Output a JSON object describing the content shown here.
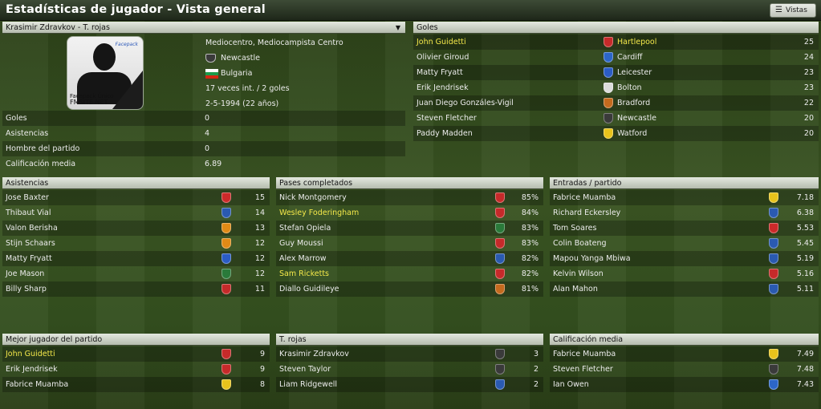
{
  "title": "Estadísticas de jugador - Vista general",
  "views_label": "Vistas",
  "player": {
    "header": "Krasimir Zdravkov - T. rojas",
    "photo_caption_1": "Facepack Único",
    "photo_caption_2": "FMSITE.NET",
    "position": "Mediocentro, Mediocampista Centro",
    "club": "Newcastle",
    "nation": "Bulgaria",
    "caps": "17 veces int. / 2 goles",
    "dob": "2-5-1994 (22 años)",
    "stats": [
      {
        "label": "Goles",
        "value": "0"
      },
      {
        "label": "Asistencias",
        "value": "4"
      },
      {
        "label": "Hombre del partido",
        "value": "0"
      },
      {
        "label": "Calificación media",
        "value": "6.89"
      }
    ]
  },
  "goles": {
    "header": "Goles",
    "rows": [
      {
        "name": "John Guidetti",
        "club": "Hartlepool",
        "value": "25",
        "hl": true,
        "c": "#c62a2a"
      },
      {
        "name": "Olivier Giroud",
        "club": "Cardiff",
        "value": "24",
        "c": "#2c66c8"
      },
      {
        "name": "Matty Fryatt",
        "club": "Leicester",
        "value": "23",
        "c": "#2b5cc4"
      },
      {
        "name": "Erik Jendrisek",
        "club": "Bolton",
        "value": "23",
        "c": "#dcdcdc"
      },
      {
        "name": "Juan Diego Gonzáles-Vigil",
        "club": "Bradford",
        "value": "22",
        "c": "#c46a1e"
      },
      {
        "name": "Steven Fletcher",
        "club": "Newcastle",
        "value": "20",
        "c": "#3a3a3a"
      },
      {
        "name": "Paddy Madden",
        "club": "Watford",
        "value": "20",
        "c": "#e8c31c"
      }
    ]
  },
  "asistencias": {
    "header": "Asistencias",
    "rows": [
      {
        "name": "Jose Baxter",
        "value": "15",
        "c": "#cc2a2a"
      },
      {
        "name": "Thibaut Vial",
        "value": "14",
        "c": "#2a5ab0"
      },
      {
        "name": "Valon Berisha",
        "value": "13",
        "c": "#e08a16"
      },
      {
        "name": "Stijn Schaars",
        "value": "12",
        "c": "#e08a16"
      },
      {
        "name": "Matty Fryatt",
        "value": "12",
        "c": "#2b5cc4"
      },
      {
        "name": "Joe Mason",
        "value": "12",
        "c": "#2a7a3a"
      },
      {
        "name": "Billy Sharp",
        "value": "11",
        "c": "#c62a2a"
      }
    ]
  },
  "pases": {
    "header": "Pases completados",
    "rows": [
      {
        "name": "Nick Montgomery",
        "value": "85%",
        "c": "#c62a2a"
      },
      {
        "name": "Wesley Foderingham",
        "value": "84%",
        "hl": true,
        "c": "#c62a2a"
      },
      {
        "name": "Stefan Opiela",
        "value": "83%",
        "c": "#2a7a3a"
      },
      {
        "name": "Guy Moussi",
        "value": "83%",
        "c": "#c62a2a"
      },
      {
        "name": "Alex Marrow",
        "value": "82%",
        "c": "#2a5ab0"
      },
      {
        "name": "Sam Ricketts",
        "value": "82%",
        "hl": true,
        "c": "#c62a2a"
      },
      {
        "name": "Diallo Guidileye",
        "value": "81%",
        "c": "#c46a1e"
      }
    ]
  },
  "entradas": {
    "header": "Entradas / partido",
    "rows": [
      {
        "name": "Fabrice Muamba",
        "value": "7.18",
        "c": "#e8c31c"
      },
      {
        "name": "Richard Eckersley",
        "value": "6.38",
        "c": "#2a5ab0"
      },
      {
        "name": "Tom Soares",
        "value": "5.53",
        "c": "#cc2a2a"
      },
      {
        "name": "Colin Boateng",
        "value": "5.45",
        "c": "#2a5ab0"
      },
      {
        "name": "Mapou Yanga Mbiwa",
        "value": "5.19",
        "c": "#2a5ab0"
      },
      {
        "name": "Kelvin Wilson",
        "value": "5.16",
        "c": "#c62a2a"
      },
      {
        "name": "Alan Mahon",
        "value": "5.11",
        "c": "#2a5ab0"
      }
    ]
  },
  "mejor": {
    "header": "Mejor jugador del partido",
    "rows": [
      {
        "name": "John Guidetti",
        "value": "9",
        "hl": true,
        "c": "#c62a2a"
      },
      {
        "name": "Erik Jendrisek",
        "value": "9",
        "c": "#c62a2a"
      },
      {
        "name": "Fabrice Muamba",
        "value": "8",
        "c": "#e8c31c"
      }
    ]
  },
  "rojas": {
    "header": "T. rojas",
    "rows": [
      {
        "name": "Krasimir Zdravkov",
        "value": "3",
        "c": "#3a3a3a"
      },
      {
        "name": "Steven Taylor",
        "value": "2",
        "c": "#3a3a3a"
      },
      {
        "name": "Liam Ridgewell",
        "value": "2",
        "c": "#2a5ab0"
      }
    ]
  },
  "calificacion": {
    "header": "Calificación media",
    "rows": [
      {
        "name": "Fabrice Muamba",
        "value": "7.49",
        "c": "#e8c31c"
      },
      {
        "name": "Steven Fletcher",
        "value": "7.48",
        "c": "#3a3a3a"
      },
      {
        "name": "Ian Owen",
        "value": "7.43",
        "c": "#2c66c8"
      }
    ]
  }
}
